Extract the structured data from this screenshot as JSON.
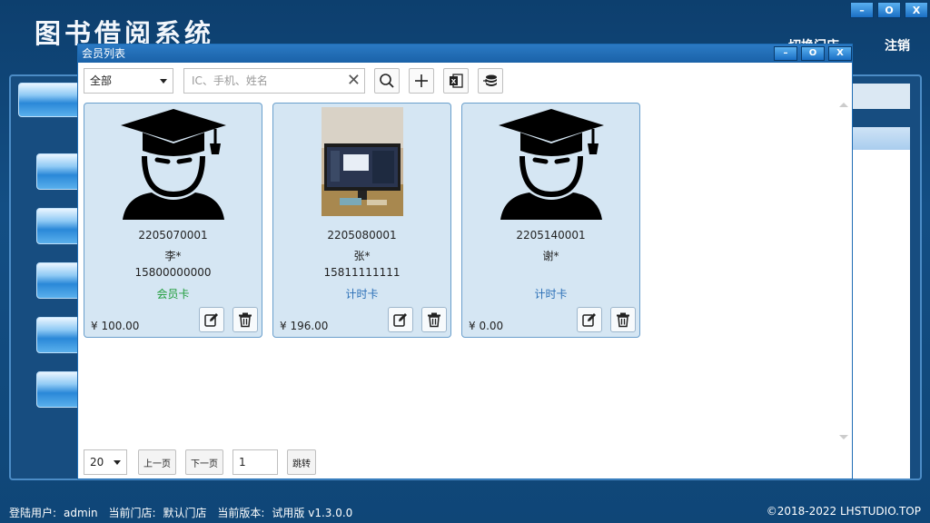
{
  "app": {
    "title": "图书借阅系统",
    "switch_store": "切换门店",
    "logout": "注销"
  },
  "window_controls": {
    "minimize": "–",
    "restore": "O",
    "close": "X"
  },
  "modal": {
    "title": "会员列表",
    "filter": {
      "selected": "全部"
    },
    "search": {
      "placeholder": "IC、手机、姓名",
      "value": ""
    },
    "toolbar_icons": [
      "search-icon",
      "add-icon",
      "excel-icon",
      "database-icon"
    ]
  },
  "members": [
    {
      "card_no": "2205070001",
      "name": "李*",
      "phone": "15800000000",
      "type": "会员卡",
      "type_kind": "member",
      "balance": "¥ 100.00",
      "avatar": "graduate-avatar-icon"
    },
    {
      "card_no": "2205080001",
      "name": "张*",
      "phone": "15811111111",
      "type": "计时卡",
      "type_kind": "timer",
      "balance": "¥ 196.00",
      "avatar": "photo-monitor"
    },
    {
      "card_no": "2205140001",
      "name": "谢*",
      "phone": "",
      "type": "计时卡",
      "type_kind": "timer",
      "balance": "¥ 0.00",
      "avatar": "graduate-avatar-icon"
    }
  ],
  "pager": {
    "page_size": "20",
    "prev": "上一页",
    "next": "下一页",
    "page": "1",
    "jump": "跳转"
  },
  "footer": {
    "user_label": "登陆用户:",
    "user": "admin",
    "store_label": "当前门店:",
    "store": "默认门店",
    "version_label": "当前版本:",
    "version": "试用版 v1.3.0.0",
    "copyright": "©2018-2022 LHSTUDIO.TOP"
  },
  "colors": {
    "accent": "#1a62a8",
    "card_bg": "#d5e6f3",
    "member_type": "#1f9c3a",
    "timer_type": "#2a6fb6"
  }
}
